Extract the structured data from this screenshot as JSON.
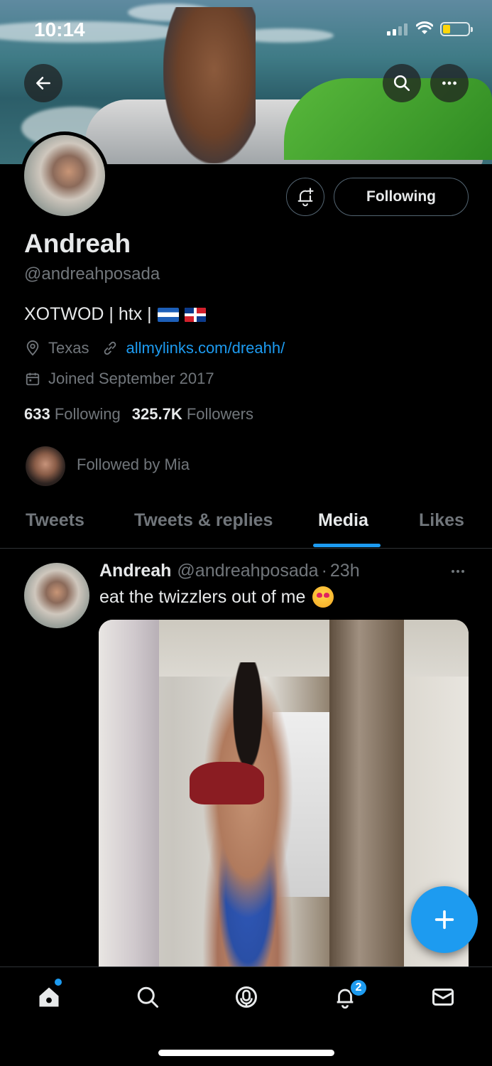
{
  "status_bar": {
    "time": "10:14"
  },
  "profile": {
    "name": "Andreah",
    "handle": "@andreahposada",
    "bio_text": "XOTWOD | htx |",
    "location": "Texas",
    "link": "allmylinks.com/dreahh/",
    "joined": "Joined September 2017",
    "following_count": "633",
    "following_label": "Following",
    "followers_count": "325.7K",
    "followers_label": "Followers",
    "followed_by": "Followed by Mia",
    "follow_button_label": "Following"
  },
  "tabs": [
    {
      "label": "Tweets",
      "active": false
    },
    {
      "label": "Tweets & replies",
      "active": false
    },
    {
      "label": "Media",
      "active": true
    },
    {
      "label": "Likes",
      "active": false
    }
  ],
  "tweet": {
    "name": "Andreah",
    "handle": "@andreahposada",
    "separator": "·",
    "time": "23h",
    "text": "eat the twizzlers out of me",
    "emoji": "smiling-face-with-heart-eyes-cat",
    "media_alt": "photo"
  },
  "tabbar": {
    "notifications_badge": "2",
    "items": [
      "home",
      "search",
      "spaces",
      "notifications",
      "messages"
    ]
  },
  "colors": {
    "accent": "#1d9bf0",
    "background": "#000000",
    "primary_text": "#e7e9ea",
    "secondary_text": "#71767b"
  }
}
